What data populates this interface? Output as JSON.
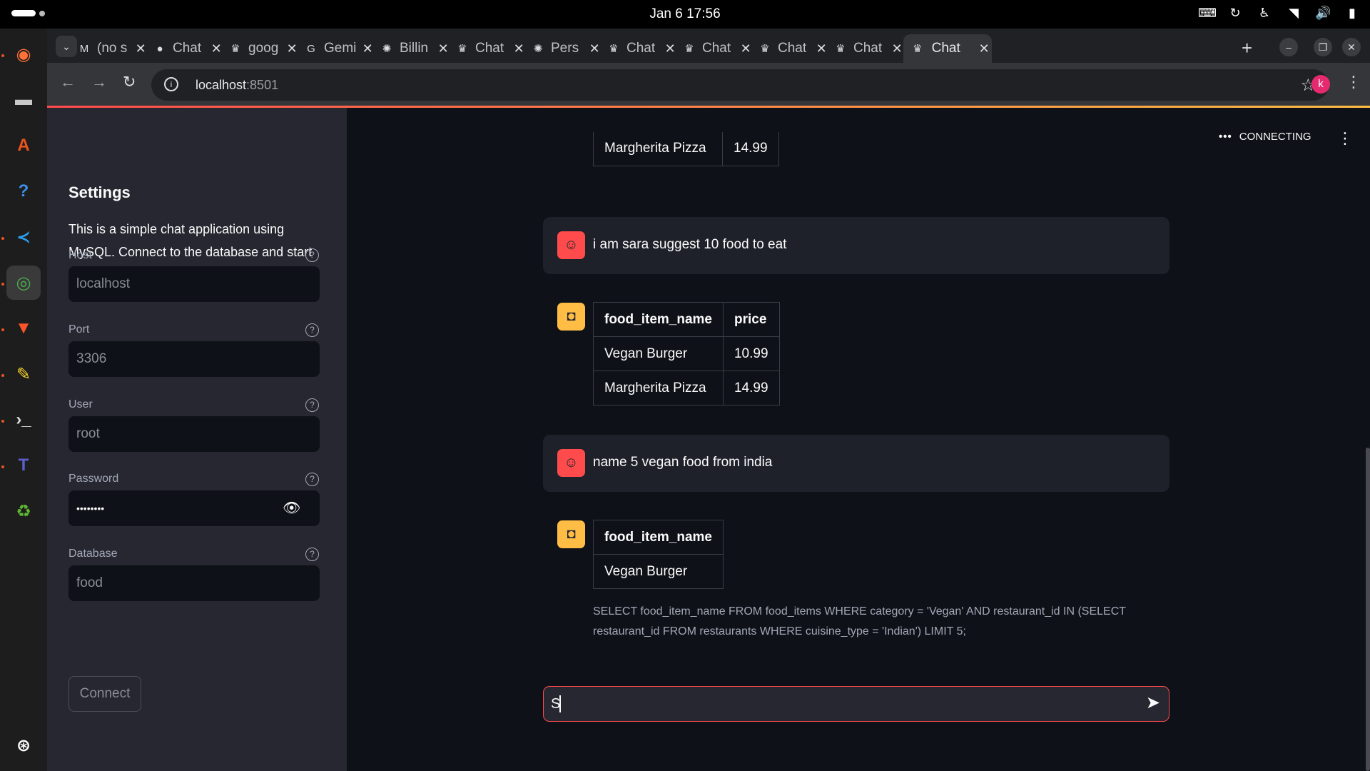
{
  "topbar": {
    "clock": "Jan 6  17:56"
  },
  "browser": {
    "tabs": [
      {
        "label": "(no s",
        "icon": "gmail-icon"
      },
      {
        "label": "Chat",
        "icon": "github-icon"
      },
      {
        "label": "goog",
        "icon": "streamlit-icon"
      },
      {
        "label": "Gemi",
        "icon": "google-icon"
      },
      {
        "label": "Billin",
        "icon": "openai-icon"
      },
      {
        "label": "Chat",
        "icon": "streamlit-icon"
      },
      {
        "label": "Pers",
        "icon": "openai-icon"
      },
      {
        "label": "Chat",
        "icon": "streamlit-icon"
      },
      {
        "label": "Chat",
        "icon": "streamlit-icon"
      },
      {
        "label": "Chat",
        "icon": "streamlit-icon"
      },
      {
        "label": "Chat",
        "icon": "streamlit-icon"
      },
      {
        "label": "Chat",
        "icon": "streamlit-icon",
        "active": true
      }
    ],
    "url_host": "localhost",
    "url_port": ":8501",
    "profile_initial": "k"
  },
  "sidebar": {
    "title": "Settings",
    "description": "This is a simple chat application using MySQL. Connect to the database and start chatting.",
    "fields": [
      {
        "label": "Host",
        "value": "localhost"
      },
      {
        "label": "Port",
        "value": "3306"
      },
      {
        "label": "User",
        "value": "root"
      },
      {
        "label": "Password",
        "value": "••••••••"
      },
      {
        "label": "Database",
        "value": "food"
      }
    ],
    "connect_label": "Connect"
  },
  "main": {
    "status": "CONNECTING",
    "partial_table": {
      "name": "Margherita Pizza",
      "price": "14.99"
    },
    "messages": [
      {
        "role": "user",
        "text": "i am sara suggest 10 food to eat"
      },
      {
        "role": "assistant",
        "columns": [
          "food_item_name",
          "price"
        ],
        "rows": [
          [
            "Vegan Burger",
            "10.99"
          ],
          [
            "Margherita Pizza",
            "14.99"
          ]
        ]
      },
      {
        "role": "user",
        "text": "name 5 vegan food from india"
      },
      {
        "role": "assistant",
        "columns": [
          "food_item_name"
        ],
        "rows": [
          [
            "Vegan Burger"
          ]
        ],
        "sql": "SELECT food_item_name FROM food_items WHERE category = 'Vegan' AND restaurant_id IN (SELECT restaurant_id FROM restaurants WHERE cuisine_type = 'Indian') LIMIT 5;"
      }
    ],
    "chat_input_value": "S"
  },
  "colors": {
    "user_avatar": "#ff4b4b",
    "bot_avatar": "#ffbd45",
    "focus_border": "#ff4b4b",
    "sidebar_bg": "#262730",
    "main_bg": "#0e1117"
  }
}
